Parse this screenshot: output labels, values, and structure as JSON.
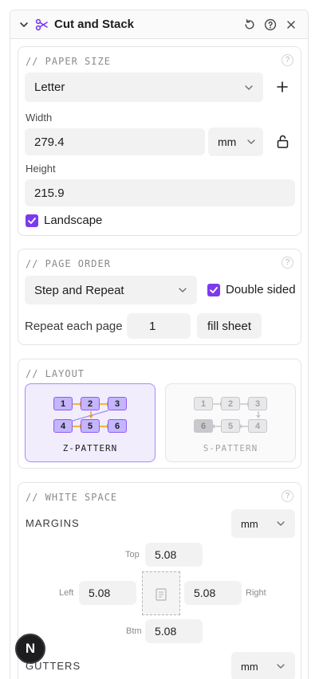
{
  "header": {
    "title": "Cut and Stack",
    "icon": "scissors-icon"
  },
  "paper_size": {
    "title": "// PAPER SIZE",
    "help": "?",
    "size_value": "Letter",
    "width_label": "Width",
    "width_value": "279.4",
    "unit_value": "mm",
    "height_label": "Height",
    "height_value": "215.9",
    "landscape_label": "Landscape",
    "landscape_checked": true
  },
  "page_order": {
    "title": "// PAGE ORDER",
    "help": "?",
    "order_value": "Step and Repeat",
    "double_sided_label": "Double sided",
    "double_sided_checked": true,
    "repeat_label": "Repeat each page",
    "repeat_value": "1",
    "fill_sheet_label": "fill sheet"
  },
  "layout": {
    "title": "// LAYOUT",
    "z_pattern": {
      "label": "Z-PATTERN",
      "cells": [
        "1",
        "2",
        "3",
        "4",
        "5",
        "6"
      ],
      "selected": true
    },
    "s_pattern": {
      "label": "S-PATTERN",
      "cells": [
        "1",
        "2",
        "3",
        "6",
        "5",
        "4"
      ],
      "selected": false
    }
  },
  "white_space": {
    "title": "// WHITE SPACE",
    "help": "?",
    "margins_label": "MARGINS",
    "margins_unit": "mm",
    "top_label": "Top",
    "top_value": "5.08",
    "left_label": "Left",
    "left_value": "5.08",
    "right_label": "Right",
    "right_value": "5.08",
    "bottom_label": "Btm",
    "bottom_value": "5.08",
    "gutters_label": "GUTTERS",
    "gutters_unit": "mm"
  },
  "fab": {
    "label": "N"
  },
  "colors": {
    "accent": "#7c3aed",
    "arrow": "#f59e0b",
    "pattern_fill": "#c4b5fd"
  }
}
